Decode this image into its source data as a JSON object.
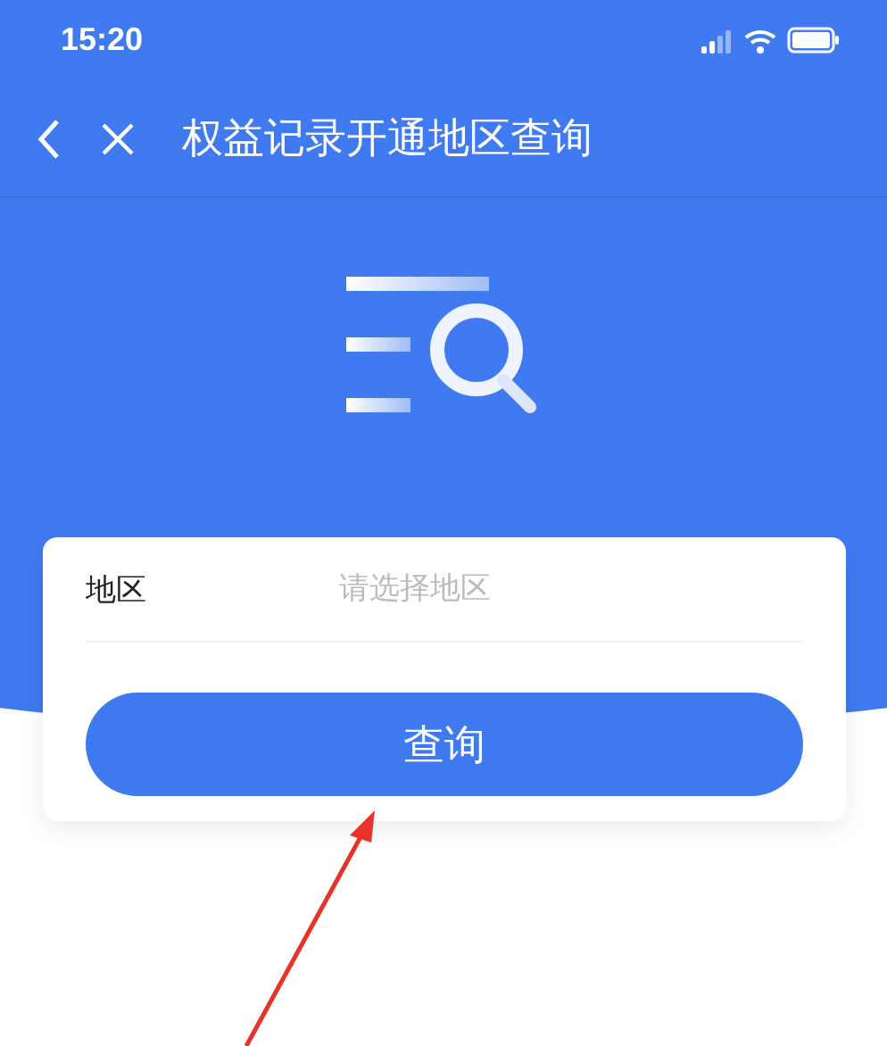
{
  "status_bar": {
    "time": "15:20"
  },
  "nav_bar": {
    "title": "权益记录开通地区查询"
  },
  "form": {
    "field": {
      "label": "地区",
      "placeholder": "请选择地区"
    },
    "button": "查询"
  }
}
